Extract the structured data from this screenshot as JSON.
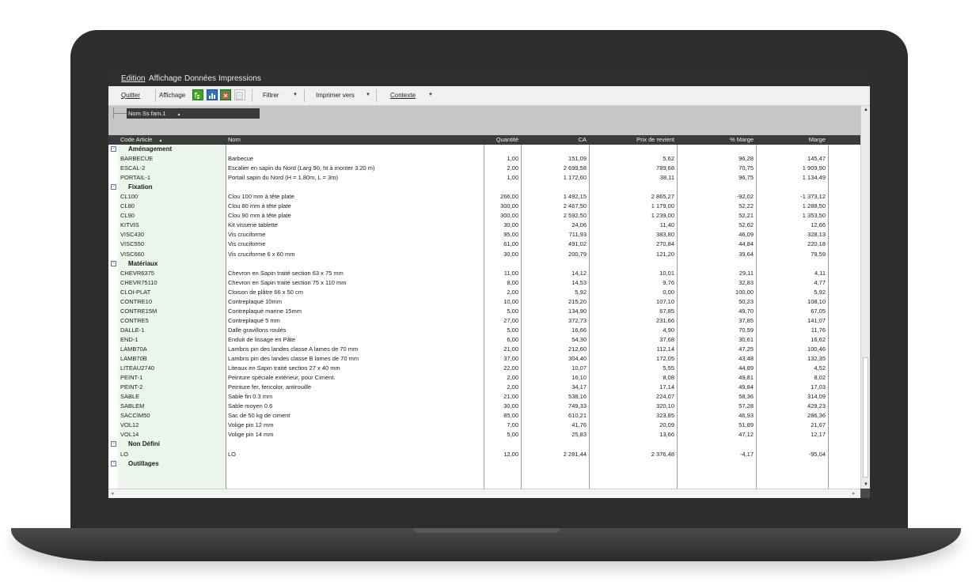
{
  "menu": [
    "Edition",
    "Affichage",
    "Données",
    "Impressions"
  ],
  "toolbar": {
    "quit_label": "Quitter",
    "view_label": "Affichage",
    "filter_label": "Filtrer",
    "print_label": "Imprimer vers",
    "context_label": "Contexte",
    "icons": [
      "tree-view-icon",
      "chart-icon",
      "excel-export-icon",
      "print-preview-icon"
    ]
  },
  "group_panel": {
    "chip_label": "Nom Ss fam.1",
    "sort_glyph": "▲"
  },
  "columns": [
    {
      "label": "Code Article",
      "sort_glyph": "▲"
    },
    {
      "label": "Nom"
    },
    {
      "label": "Quantité"
    },
    {
      "label": "CA"
    },
    {
      "label": "Prix de revient"
    },
    {
      "label": "% Marge"
    },
    {
      "label": "Marge"
    }
  ],
  "rows": [
    {
      "type": "group",
      "name": "Aménagement",
      "toggle": "−"
    },
    {
      "type": "item",
      "code": "BARBECUE",
      "nom": "Barbecue",
      "qte": "1,00",
      "ca": "151,09",
      "prix": "5,62",
      "pmarge": "96,28",
      "marge": "145,47"
    },
    {
      "type": "item",
      "code": "ESCAL-2",
      "nom": "Escalier en sapin du Nord (Larg 90, ht à monter 3.20 m)",
      "qte": "2,00",
      "ca": "2 699,58",
      "prix": "789,68",
      "pmarge": "70,75",
      "marge": "1 909,90"
    },
    {
      "type": "item",
      "code": "PORTAIL-1",
      "nom": "Portail sapin du Nord (H = 1.80m, L = 3m)",
      "qte": "1,00",
      "ca": "1 172,60",
      "prix": "38,11",
      "pmarge": "96,75",
      "marge": "1 134,49"
    },
    {
      "type": "group",
      "name": "Fixation",
      "toggle": "−"
    },
    {
      "type": "item",
      "code": "CL100",
      "nom": "Clou 100 mm à tête plate",
      "qte": "266,00",
      "ca": "1 492,15",
      "prix": "2 865,27",
      "pmarge": "-92,02",
      "marge": "-1 373,12"
    },
    {
      "type": "item",
      "code": "CL80",
      "nom": "Clou 80 mm à tête plate",
      "qte": "300,00",
      "ca": "2 467,50",
      "prix": "1 179,00",
      "pmarge": "52,22",
      "marge": "1 288,50"
    },
    {
      "type": "item",
      "code": "CL90",
      "nom": "Clou 90 mm à tête plate",
      "qte": "300,00",
      "ca": "2 592,50",
      "prix": "1 239,00",
      "pmarge": "52,21",
      "marge": "1 353,50"
    },
    {
      "type": "item",
      "code": "KITVIS",
      "nom": "Kit visserie tablette",
      "qte": "30,00",
      "ca": "24,06",
      "prix": "11,40",
      "pmarge": "52,62",
      "marge": "12,66"
    },
    {
      "type": "item",
      "code": "VISC430",
      "nom": "Vis cruciforme",
      "qte": "95,00",
      "ca": "711,93",
      "prix": "383,80",
      "pmarge": "46,09",
      "marge": "328,13"
    },
    {
      "type": "item",
      "code": "VISC550",
      "nom": "Vis cruciforme",
      "qte": "61,00",
      "ca": "491,02",
      "prix": "270,84",
      "pmarge": "44,84",
      "marge": "220,18"
    },
    {
      "type": "item",
      "code": "VISC660",
      "nom": "Vis cruciforme 6 x 60 mm",
      "qte": "30,00",
      "ca": "200,79",
      "prix": "121,20",
      "pmarge": "39,64",
      "marge": "79,59"
    },
    {
      "type": "group",
      "name": "Matériaux",
      "toggle": "−"
    },
    {
      "type": "item",
      "code": "CHEVR6375",
      "nom": "Chevron en Sapin traité section 63 x 75 mm",
      "qte": "11,00",
      "ca": "14,12",
      "prix": "10,01",
      "pmarge": "29,11",
      "marge": "4,11"
    },
    {
      "type": "item",
      "code": "CHEVR75110",
      "nom": "Chevron en Sapin traité section 75 x 110 mm",
      "qte": "8,00",
      "ca": "14,53",
      "prix": "9,76",
      "pmarge": "32,83",
      "marge": "4,77"
    },
    {
      "type": "item",
      "code": "CLOI-PLAT",
      "nom": "Cloison de plâtre 66 x 50 cm",
      "qte": "2,00",
      "ca": "5,92",
      "prix": "0,00",
      "pmarge": "100,00",
      "marge": "5,92"
    },
    {
      "type": "item",
      "code": "CONTRE10",
      "nom": "Contreplaqué 10mm",
      "qte": "10,00",
      "ca": "215,20",
      "prix": "107,10",
      "pmarge": "50,23",
      "marge": "108,10"
    },
    {
      "type": "item",
      "code": "CONTRE15M",
      "nom": "Contreplaqué marine 15mm",
      "qte": "5,00",
      "ca": "134,90",
      "prix": "67,85",
      "pmarge": "49,70",
      "marge": "67,05"
    },
    {
      "type": "item",
      "code": "CONTRE5",
      "nom": "Contreplaqué 5 mm",
      "qte": "27,00",
      "ca": "372,73",
      "prix": "231,66",
      "pmarge": "37,85",
      "marge": "141,07"
    },
    {
      "type": "item",
      "code": "DALLE-1",
      "nom": "Dalle gravillons roulés",
      "qte": "5,00",
      "ca": "16,66",
      "prix": "4,90",
      "pmarge": "70,59",
      "marge": "11,76"
    },
    {
      "type": "item",
      "code": "END-1",
      "nom": "Enduit de lissage en Pâte",
      "qte": "6,00",
      "ca": "54,30",
      "prix": "37,68",
      "pmarge": "30,61",
      "marge": "16,62"
    },
    {
      "type": "item",
      "code": "LAMB70A",
      "nom": "Lambris pin des landes classe A lames de 70 mm",
      "qte": "21,00",
      "ca": "212,60",
      "prix": "112,14",
      "pmarge": "47,25",
      "marge": "100,46"
    },
    {
      "type": "item",
      "code": "LAMB70B",
      "nom": "Lambris pin des landes classe B lames de 70 mm",
      "qte": "37,00",
      "ca": "304,40",
      "prix": "172,05",
      "pmarge": "43,48",
      "marge": "132,35"
    },
    {
      "type": "item",
      "code": "LITEAU2740",
      "nom": "Liteaux en Sapin traité section 27 x 40 mm",
      "qte": "22,00",
      "ca": "10,07",
      "prix": "5,55",
      "pmarge": "44,89",
      "marge": "4,52"
    },
    {
      "type": "item",
      "code": "PEINT-1",
      "nom": "Peinture spéciale extérieur, pour Ciment.",
      "qte": "2,00",
      "ca": "16,10",
      "prix": "8,08",
      "pmarge": "49,81",
      "marge": "8,02"
    },
    {
      "type": "item",
      "code": "PEINT-2",
      "nom": "Peinture fer, fericolor, antirouille",
      "qte": "2,00",
      "ca": "34,17",
      "prix": "17,14",
      "pmarge": "49,84",
      "marge": "17,03"
    },
    {
      "type": "item",
      "code": "SABLE",
      "nom": "Sable fin 0.3 mm",
      "qte": "21,00",
      "ca": "538,16",
      "prix": "224,07",
      "pmarge": "58,36",
      "marge": "314,09"
    },
    {
      "type": "item",
      "code": "SABLEM",
      "nom": "Sable moyen 0.6",
      "qte": "30,00",
      "ca": "749,33",
      "prix": "320,10",
      "pmarge": "57,28",
      "marge": "429,23"
    },
    {
      "type": "item",
      "code": "SACCIM50",
      "nom": "Sac de 50 kg de ciment",
      "qte": "85,00",
      "ca": "610,21",
      "prix": "323,85",
      "pmarge": "46,93",
      "marge": "286,36"
    },
    {
      "type": "item",
      "code": "VOL12",
      "nom": "Volige pin 12 mm",
      "qte": "7,00",
      "ca": "41,76",
      "prix": "20,09",
      "pmarge": "51,89",
      "marge": "21,67"
    },
    {
      "type": "item",
      "code": "VOL14",
      "nom": "Volige pin 14 mm",
      "qte": "5,00",
      "ca": "25,83",
      "prix": "13,66",
      "pmarge": "47,12",
      "marge": "12,17"
    },
    {
      "type": "group",
      "name": "Non Défini",
      "toggle": "−"
    },
    {
      "type": "item",
      "code": "LO",
      "nom": "LO",
      "qte": "12,00",
      "ca": "2 281,44",
      "prix": "2 376,48",
      "pmarge": "-4,17",
      "marge": "-95,04"
    },
    {
      "type": "group",
      "name": "Outillages",
      "toggle": "−"
    }
  ],
  "colors": {
    "menubar": "#2f2f2f",
    "header": "#3b3b3b",
    "code_column_bg": "#edf6ec",
    "group_area": "#c6c6c6"
  }
}
